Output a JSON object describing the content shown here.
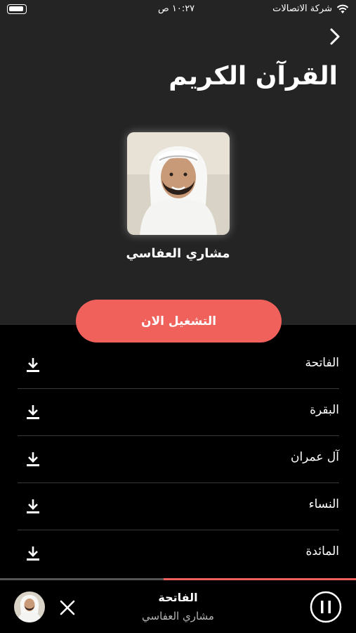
{
  "status_bar": {
    "carrier": "شركة الاتصالات",
    "time": "١٠:٢٧ ص"
  },
  "header": {
    "title": "القرآن الكريم"
  },
  "reciter": {
    "name": "مشاري العفاسي"
  },
  "play_button": {
    "label": "التشغيل الان"
  },
  "surahs": [
    {
      "name": "الفاتحة"
    },
    {
      "name": "البقرة"
    },
    {
      "name": "آل عمران"
    },
    {
      "name": "النساء"
    },
    {
      "name": "المائدة"
    }
  ],
  "now_playing": {
    "title": "الفاتحة",
    "reciter": "مشاري العفاسي",
    "progress": 0.54
  },
  "colors": {
    "accent": "#f0615c",
    "background_top": "#242424",
    "background": "#000000"
  },
  "icons": [
    "battery-icon",
    "wifi-icon",
    "chevron-right-icon",
    "download-icon",
    "close-icon",
    "pause-icon"
  ]
}
